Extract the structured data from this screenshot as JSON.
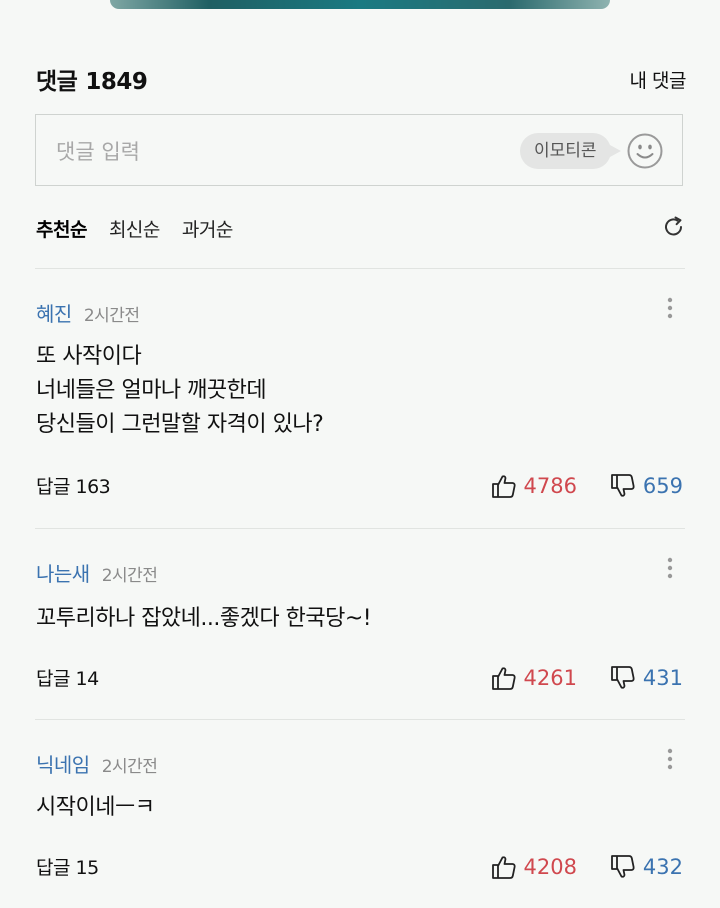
{
  "header": {
    "title": "댓글",
    "count": "1849",
    "my_comments": "내 댓글"
  },
  "input": {
    "placeholder": "댓글 입력",
    "emoticon_label": "이모티콘"
  },
  "sort": {
    "options": [
      "추천순",
      "최신순",
      "과거순"
    ],
    "active": "추천순"
  },
  "colors": {
    "author": "#3b73b0",
    "like": "#d0484e",
    "dislike": "#3b73b0"
  },
  "comments": [
    {
      "author": "혜진",
      "time": "2시간전",
      "lines": [
        "또 사작이다",
        "너네들은 얼마나 깨끗한데",
        "당신들이 그런말할 자격이 있나?"
      ],
      "reply": "답글 163",
      "likes": "4786",
      "dislikes": "659"
    },
    {
      "author": "나는새",
      "time": "2시간전",
      "lines": [
        "꼬투리하나 잡았네...좋겠다 한국당~!"
      ],
      "reply": "답글 14",
      "likes": "4261",
      "dislikes": "431"
    },
    {
      "author": "닉네임",
      "time": "2시간전",
      "lines": [
        "시작이네ㅡㅋ"
      ],
      "reply": "답글 15",
      "likes": "4208",
      "dislikes": "432"
    }
  ]
}
